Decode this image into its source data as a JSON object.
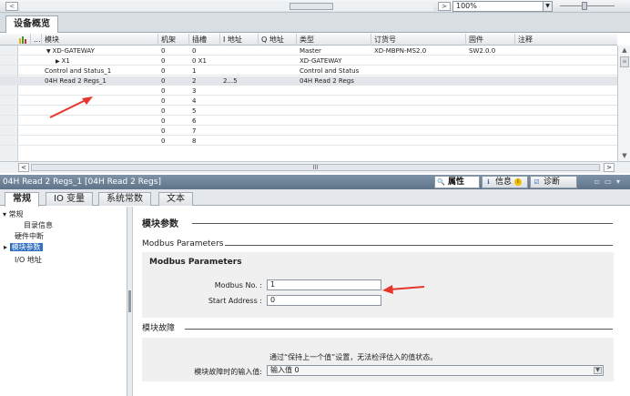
{
  "topbar": {
    "zoom": "100%",
    "scroll_left": "<",
    "scroll_right": ">"
  },
  "device_tab": {
    "label": "设备概览"
  },
  "table": {
    "headers": {
      "flag": "",
      "module": "模块",
      "rack": "机架",
      "slot": "插槽",
      "iaddr": "I 地址",
      "qaddr": "Q 地址",
      "type": "类型",
      "order": "订货号",
      "firmware": "固件",
      "comment": "注释"
    },
    "rows": [
      {
        "module": "XD-GATEWAY",
        "rack": "0",
        "slot": "0",
        "iaddr": "",
        "type": "Master",
        "order": "XD-MBPN-MS2.0",
        "firmware": "SW2.0.0"
      },
      {
        "module": "X1",
        "rack": "0",
        "slot": "0 X1",
        "iaddr": "",
        "type": "XD-GATEWAY",
        "order": "",
        "firmware": ""
      },
      {
        "module": "Control and Status_1",
        "rack": "0",
        "slot": "1",
        "iaddr": "",
        "type": "Control and Status",
        "order": "",
        "firmware": ""
      },
      {
        "module": "04H Read 2 Regs_1",
        "rack": "0",
        "slot": "2",
        "iaddr": "2...5",
        "type": "04H Read 2 Regs",
        "order": "",
        "firmware": ""
      },
      {
        "module": "",
        "rack": "0",
        "slot": "3",
        "iaddr": "",
        "type": "",
        "order": "",
        "firmware": ""
      },
      {
        "module": "",
        "rack": "0",
        "slot": "4",
        "iaddr": "",
        "type": "",
        "order": "",
        "firmware": ""
      },
      {
        "module": "",
        "rack": "0",
        "slot": "5",
        "iaddr": "",
        "type": "",
        "order": "",
        "firmware": ""
      },
      {
        "module": "",
        "rack": "0",
        "slot": "6",
        "iaddr": "",
        "type": "",
        "order": "",
        "firmware": ""
      },
      {
        "module": "",
        "rack": "0",
        "slot": "7",
        "iaddr": "",
        "type": "",
        "order": "",
        "firmware": ""
      },
      {
        "module": "",
        "rack": "0",
        "slot": "8",
        "iaddr": "",
        "type": "",
        "order": "",
        "firmware": ""
      }
    ],
    "hscroll_mark": "III"
  },
  "inspector": {
    "title": "04H Read 2 Regs_1 [04H Read 2 Regs]",
    "btn_properties": "属性",
    "btn_info": "信息",
    "btn_diagnostics": "诊断",
    "tabs": [
      "常规",
      "IO 变量",
      "系统常数",
      "文本"
    ]
  },
  "nav": {
    "general": "常规",
    "catalog": "目录信息",
    "hw_interrupt": "硬件中断",
    "module_params": "模块参数",
    "io_addr": "I/O 地址"
  },
  "params": {
    "section_title": "模块参数",
    "modbus_header": "Modbus Parameters",
    "group_title": "Modbus Parameters",
    "modbus_no_label": "Modbus No. :",
    "modbus_no_value": "1",
    "start_addr_label": "Start Address :",
    "start_addr_value": "0",
    "fault_section": "模块故障",
    "fault_note": "通过“保持上一个值”设置，无法检评估入的值状态。",
    "fault_label": "模块故障时的输入值:",
    "fault_value": "输入值 0"
  },
  "colors": {
    "annotation_arrow": "#e8352b",
    "selected_nav": "#2f6fc0"
  }
}
